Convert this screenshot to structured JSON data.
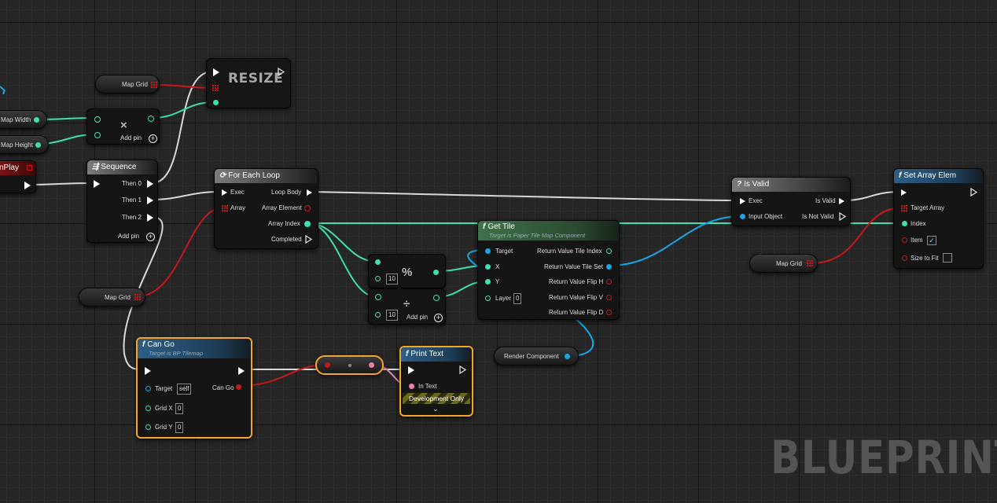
{
  "colors": {
    "exec": "#ffffff",
    "int": "#3ee0b2",
    "object": "#1aa7e8",
    "struct_array": "#c8181c",
    "string": "#f07fb0",
    "bool": "#c8181c",
    "selected": "#f3a629"
  },
  "graph": {
    "watermark": "BLUEPRINT"
  },
  "nodes": {
    "map_grid_1": {
      "label": "Map Grid"
    },
    "map_grid_2": {
      "label": "Map Grid"
    },
    "map_grid_3": {
      "label": "Map Grid"
    },
    "map_width": {
      "label": "Map Width"
    },
    "map_height": {
      "label": "Map Height"
    },
    "begin_play": {
      "label": "nPlay"
    },
    "resize": {
      "title": "RESIZE"
    },
    "multiply": {
      "symbol": "×",
      "add_pin": "Add pin"
    },
    "sequence": {
      "title": "Sequence",
      "then0": "Then 0",
      "then1": "Then 1",
      "then2": "Then 2",
      "add_pin": "Add pin"
    },
    "for_each": {
      "title": "For Each Loop",
      "exec": "Exec",
      "array": "Array",
      "loop_body": "Loop Body",
      "array_element": "Array Element",
      "array_index": "Array Index",
      "completed": "Completed"
    },
    "modulo": {
      "symbol": "%",
      "value": "10"
    },
    "divide": {
      "symbol": "÷",
      "value": "10",
      "add_pin": "Add pin"
    },
    "get_tile": {
      "title": "Get Tile",
      "subtitle": "Target is Paper Tile Map Component",
      "target": "Target",
      "x": "X",
      "y": "Y",
      "layer": "Layer",
      "layer_value": "0",
      "rv_index": "Return Value Tile Index",
      "rv_set": "Return Value Tile Set",
      "rv_flip_h": "Return Value Flip H",
      "rv_flip_v": "Return Value Flip V",
      "rv_flip_d": "Return Value Flip D"
    },
    "render_component": {
      "label": "Render Component"
    },
    "is_valid": {
      "title": "Is Valid",
      "exec": "Exec",
      "input_object": "Input Object",
      "is_valid": "Is Valid",
      "is_not_valid": "Is Not Valid"
    },
    "set_array_elem": {
      "title": "Set Array Elem",
      "target_array": "Target Array",
      "index": "Index",
      "item": "Item",
      "size_to_fit": "Size to Fit",
      "item_checked": "✓"
    },
    "can_go": {
      "title": "Can Go",
      "subtitle": "Target is BP Tilemap",
      "target": "Target",
      "target_value": "self",
      "can_go": "Can Go",
      "grid_x": "Grid X",
      "grid_x_value": "0",
      "grid_y": "Grid Y",
      "grid_y_value": "0"
    },
    "print_text": {
      "title": "Print Text",
      "in_text": "In Text",
      "dev_only": "Development Only",
      "expand": "⌄"
    }
  }
}
